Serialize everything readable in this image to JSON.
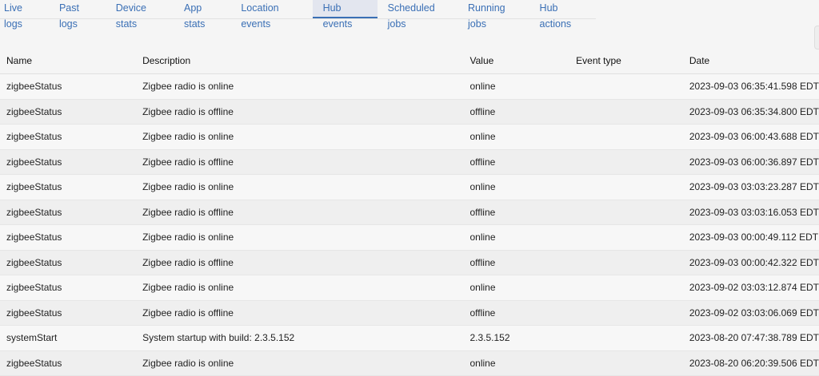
{
  "tabs": [
    {
      "label": "Live logs",
      "active": false
    },
    {
      "label": "Past logs",
      "active": false
    },
    {
      "label": "Device stats",
      "active": false
    },
    {
      "label": "App stats",
      "active": false
    },
    {
      "label": "Location events",
      "active": false
    },
    {
      "label": "Hub events",
      "active": true
    },
    {
      "label": "Scheduled jobs",
      "active": false
    },
    {
      "label": "Running jobs",
      "active": false
    },
    {
      "label": "Hub actions",
      "active": false
    }
  ],
  "table": {
    "columns": [
      "Name",
      "Description",
      "Value",
      "Event type",
      "Date"
    ],
    "rows": [
      [
        "zigbeeStatus",
        "Zigbee radio is online",
        "online",
        "",
        "2023-09-03 06:35:41.598 EDT"
      ],
      [
        "zigbeeStatus",
        "Zigbee radio is offline",
        "offline",
        "",
        "2023-09-03 06:35:34.800 EDT"
      ],
      [
        "zigbeeStatus",
        "Zigbee radio is online",
        "online",
        "",
        "2023-09-03 06:00:43.688 EDT"
      ],
      [
        "zigbeeStatus",
        "Zigbee radio is offline",
        "offline",
        "",
        "2023-09-03 06:00:36.897 EDT"
      ],
      [
        "zigbeeStatus",
        "Zigbee radio is online",
        "online",
        "",
        "2023-09-03 03:03:23.287 EDT"
      ],
      [
        "zigbeeStatus",
        "Zigbee radio is offline",
        "offline",
        "",
        "2023-09-03 03:03:16.053 EDT"
      ],
      [
        "zigbeeStatus",
        "Zigbee radio is online",
        "online",
        "",
        "2023-09-03 00:00:49.112 EDT"
      ],
      [
        "zigbeeStatus",
        "Zigbee radio is offline",
        "offline",
        "",
        "2023-09-03 00:00:42.322 EDT"
      ],
      [
        "zigbeeStatus",
        "Zigbee radio is online",
        "online",
        "",
        "2023-09-02 03:03:12.874 EDT"
      ],
      [
        "zigbeeStatus",
        "Zigbee radio is offline",
        "offline",
        "",
        "2023-09-02 03:03:06.069 EDT"
      ],
      [
        "systemStart",
        "System startup with build: 2.3.5.152",
        "2.3.5.152",
        "",
        "2023-08-20 07:47:38.789 EDT"
      ],
      [
        "zigbeeStatus",
        "Zigbee radio is online",
        "online",
        "",
        "2023-08-20 06:20:39.506 EDT"
      ]
    ]
  }
}
